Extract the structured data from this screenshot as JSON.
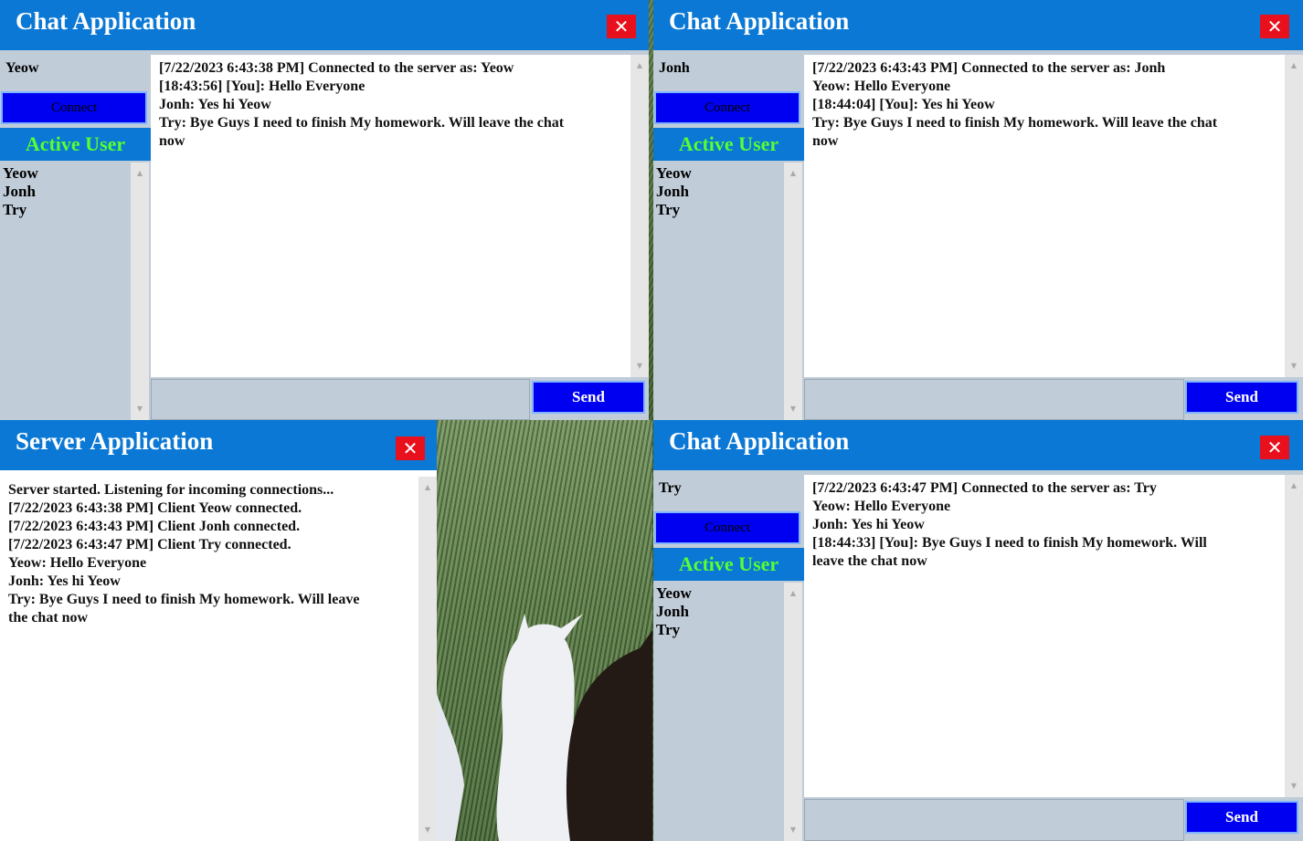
{
  "windows": {
    "chat1": {
      "title": "Chat Application",
      "close_glyph": "✕",
      "username": "Yeow",
      "connect_label": "Connect",
      "active_label": "Active User",
      "users": [
        "Yeow",
        "Jonh",
        "Try"
      ],
      "messages": [
        "[7/22/2023 6:43:38 PM] Connected to the server as: Yeow",
        "[18:43:56] [You]: Hello Everyone",
        "Jonh: Yes hi Yeow",
        "Try: Bye Guys I need to finish My homework. Will leave the chat",
        "now"
      ],
      "send_label": "Send"
    },
    "chat2": {
      "title": "Chat Application",
      "close_glyph": "✕",
      "username": "Jonh",
      "connect_label": "Connect",
      "active_label": "Active User",
      "users": [
        "Yeow",
        "Jonh",
        "Try"
      ],
      "messages": [
        "[7/22/2023 6:43:43 PM] Connected to the server as: Jonh",
        "Yeow: Hello Everyone",
        "[18:44:04] [You]: Yes hi Yeow",
        "Try: Bye Guys I need to finish My homework. Will leave the chat",
        "now"
      ],
      "send_label": "Send"
    },
    "server": {
      "title": "Server Application",
      "close_glyph": "✕",
      "messages": [
        "Server started. Listening for incoming connections...",
        "[7/22/2023 6:43:38 PM] Client Yeow connected.",
        "[7/22/2023 6:43:43 PM] Client Jonh connected.",
        "[7/22/2023 6:43:47 PM] Client Try connected.",
        "Yeow: Hello Everyone",
        "Jonh: Yes hi Yeow",
        "Try: Bye Guys I need to finish My homework. Will leave",
        "the chat now"
      ]
    },
    "chat3": {
      "title": "Chat Application",
      "close_glyph": "✕",
      "username": "Try",
      "connect_label": "Connect",
      "active_label": "Active User",
      "users": [
        "Yeow",
        "Jonh",
        "Try"
      ],
      "messages": [
        "[7/22/2023 6:43:47 PM] Connected to the server as: Try",
        "Yeow: Hello Everyone",
        "Jonh: Yes hi Yeow",
        "[18:44:33] [You]: Bye Guys I need to finish My homework. Will",
        "leave the chat now"
      ],
      "send_label": "Send"
    }
  },
  "scroll_glyphs": {
    "up": "▲",
    "down": "▼"
  },
  "colors": {
    "titlebar": "#0a78d4",
    "button": "#0000f0",
    "active_user_text": "#55ff33",
    "close": "#e8101c",
    "panel": "#c0ccd8"
  }
}
